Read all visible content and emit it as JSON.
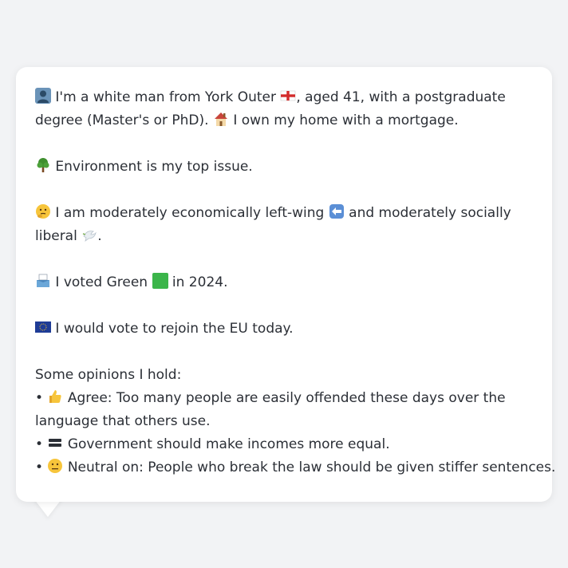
{
  "profile": {
    "intro_a": "I'm a white man from York Outer",
    "intro_b": ", aged 41, with a postgraduate degree (Master's or PhD).",
    "intro_c": "I own my home with a mortgage.",
    "issue": "Environment is my top issue.",
    "politics_a": "I am moderately economically left-wing",
    "politics_b": "and moderately socially liberal",
    "politics_c": ".",
    "vote_a": "I voted Green",
    "vote_b": "in 2024.",
    "eu": "I would vote to rejoin the EU today.",
    "opinions_heading": "Some opinions I hold:",
    "opinions": [
      {
        "bullet": "•",
        "text": "Agree: Too many people are easily offended these days over the language that others use.",
        "icon": "thumbs-up-icon"
      },
      {
        "bullet": "•",
        "text": "Government should make incomes more equal.",
        "icon": "equals-icon"
      },
      {
        "bullet": "•",
        "text": "Neutral on: People who break the law should be given stiffer sentences.",
        "icon": "neutral-face-icon"
      }
    ]
  },
  "icons": {
    "person": "person-silhouette-icon",
    "flag": "england-flag-icon",
    "house": "house-icon",
    "tree": "tree-icon",
    "thinking": "thinking-face-icon",
    "left_arrow": "left-arrow-icon",
    "dove": "dove-icon",
    "ballot": "ballot-box-icon",
    "green_square": "green-square-icon",
    "eu_flag": "eu-flag-icon"
  },
  "colors": {
    "background": "#f2f3f5",
    "card": "#ffffff",
    "text": "#2b2f36",
    "green": "#3bb54a",
    "eu_blue": "#1f3c96"
  }
}
